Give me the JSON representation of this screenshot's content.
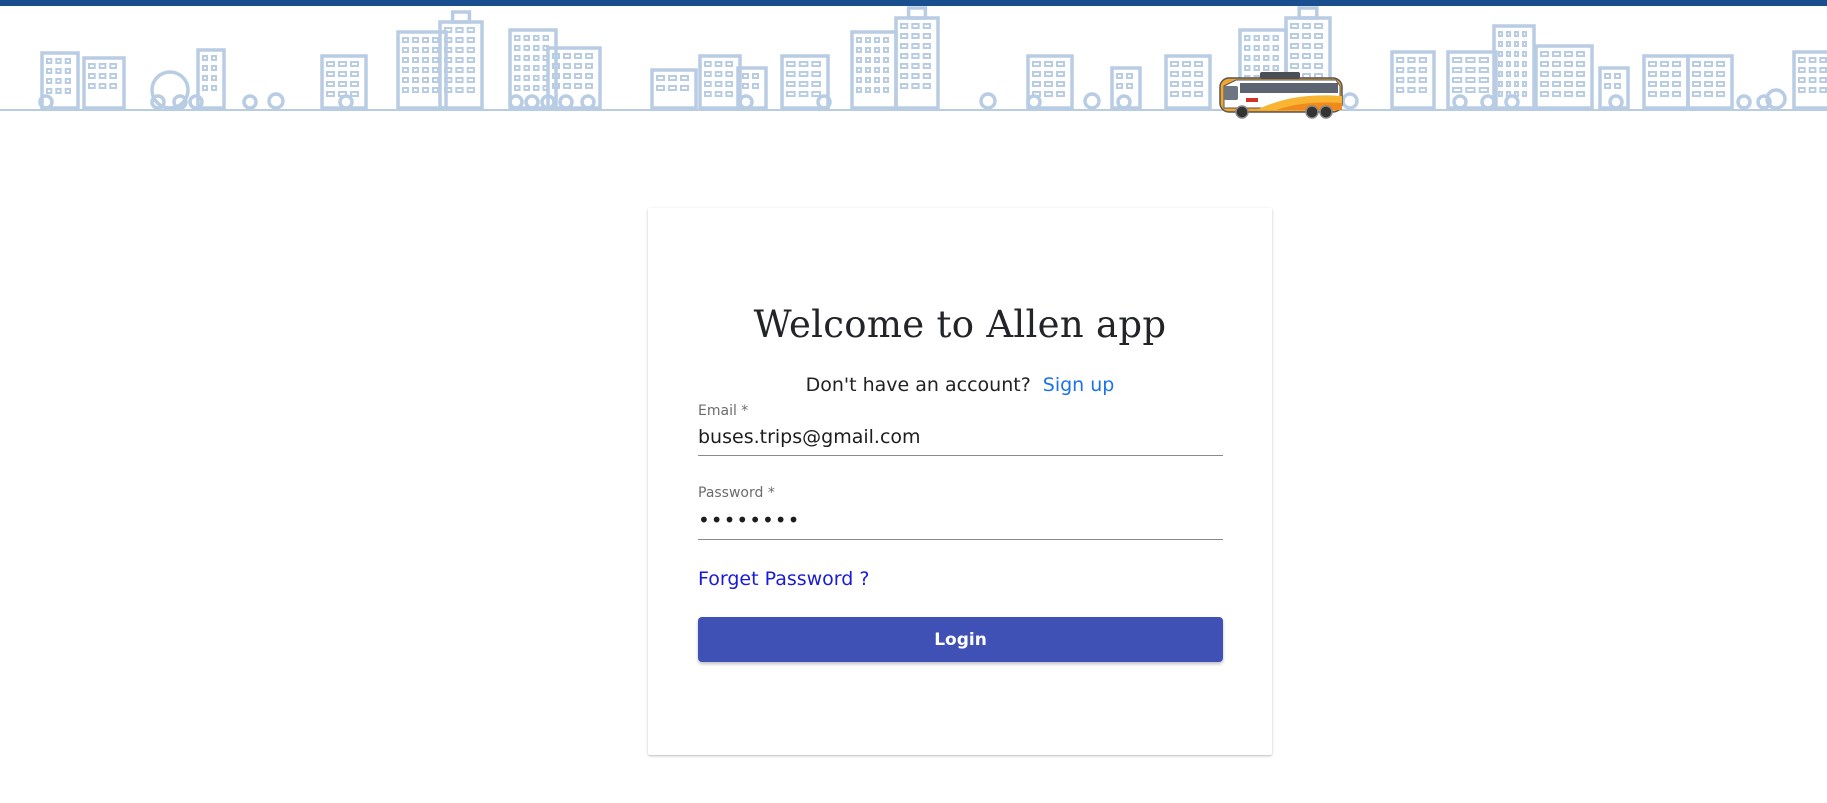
{
  "header": {
    "brand_color": "#1a4f8f",
    "illustration": "city-skyline-with-bus"
  },
  "login": {
    "title": "Welcome to Allen app",
    "signup_prompt": "Don't have an account?",
    "signup_link": "Sign up",
    "email": {
      "label": "Email *",
      "value": "buses.trips@gmail.com"
    },
    "password": {
      "label": "Password *",
      "value": "••••••••"
    },
    "forgot_link": "Forget Password ?",
    "login_button": "Login",
    "button_color": "#3f51b5"
  }
}
